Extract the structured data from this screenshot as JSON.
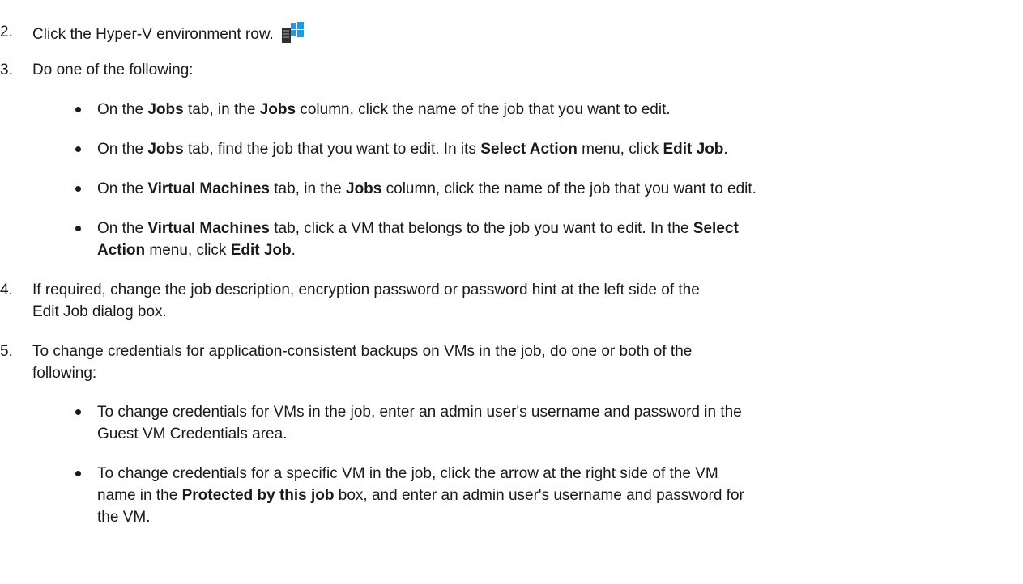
{
  "steps": [
    {
      "num": "2.",
      "text": "Click the Hyper-V environment row.",
      "icon": "hyper-v-environment-icon"
    },
    {
      "num": "3.",
      "text": "Do one of the following:"
    },
    {
      "num": "4.",
      "line1": "If required, change the job description, encryption password or password hint at the left side of the",
      "line2": "Edit Job dialog box."
    },
    {
      "num": "5.",
      "line1": "To change credentials for application-consistent backups on VMs in the job, do one or both of the",
      "line2": "following:"
    }
  ],
  "step3_bullets": {
    "b1": {
      "t1": "On the ",
      "b1": "Jobs",
      "t2": " tab, in the ",
      "b2": "Jobs",
      "t3": " column, click the name of the job that you want to edit."
    },
    "b2": {
      "t1": "On the ",
      "b1": "Jobs",
      "t2": " tab, find the job that you want to edit. In its ",
      "b2": "Select Action",
      "t3": " menu, click ",
      "b3": "Edit Job",
      "t4": "."
    },
    "b3": {
      "t1": "On the ",
      "b1": "Virtual Machines",
      "t2": " tab, in the ",
      "b2": "Jobs",
      "t3": " column, click the name of the job that you want to edit."
    },
    "b4": {
      "t1": "On the ",
      "b1": "Virtual Machines",
      "t2": " tab, click a VM that belongs to the job you want to edit. In the ",
      "b2": "Select",
      "b3": "Action",
      "t3": " menu, click ",
      "b4": "Edit Job",
      "t4": "."
    }
  },
  "step5_bullets": {
    "b1": {
      "line1": "To change credentials for VMs in the job, enter an admin user's username and password in the",
      "line2": "Guest VM Credentials area."
    },
    "b2": {
      "line1": "To change credentials for a specific VM in the job, click the arrow at the right side of the VM",
      "t1": "name in the ",
      "b1": "Protected by this job",
      "t2": " box, and enter an admin user's username and password for",
      "line3": "the VM."
    }
  },
  "colors": {
    "text": "#1a1a1a",
    "background": "#ffffff",
    "icon_blue": "#1e9be0"
  }
}
